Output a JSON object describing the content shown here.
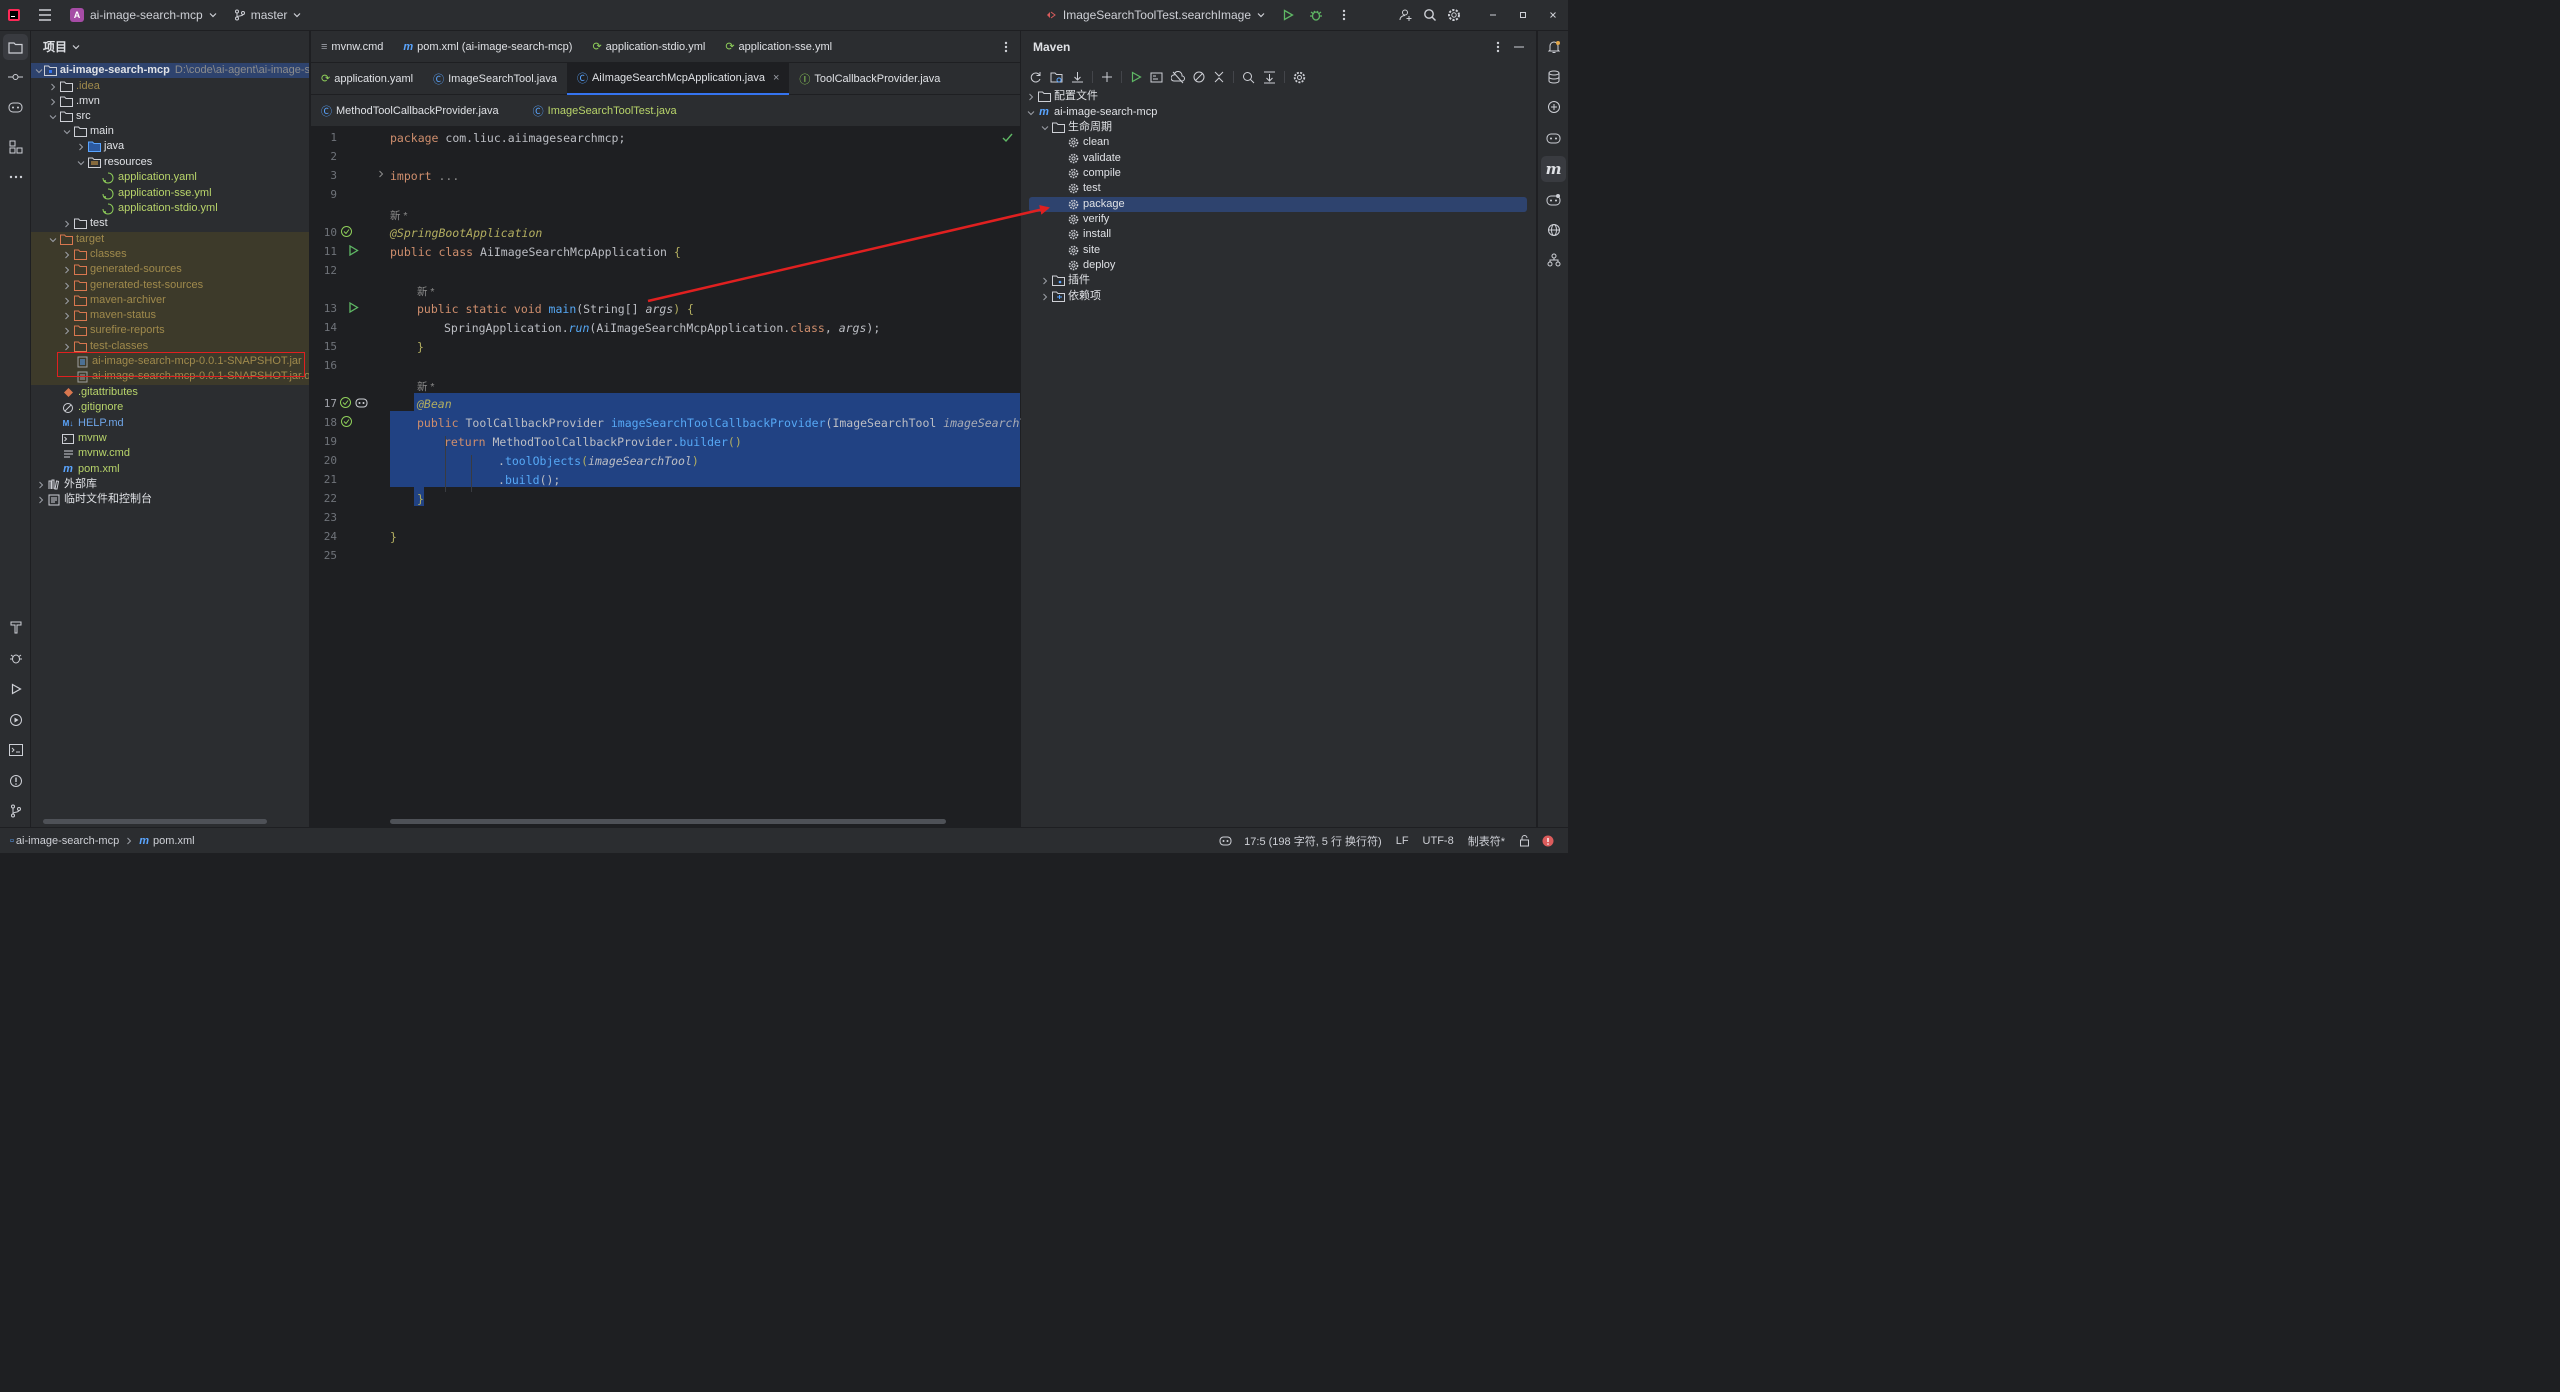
{
  "titlebar": {
    "project_badge": "A",
    "project_name": "ai-image-search-mcp",
    "branch": "master",
    "run_config": "ImageSearchToolTest.searchImage",
    "icons": [
      "app-logo-icon",
      "hamburger-menu-icon",
      "branch-icon",
      "run-icon",
      "debug-icon",
      "more-vert-icon",
      "add-user-icon",
      "search-icon",
      "settings-icon",
      "minimize-icon",
      "restore-icon",
      "close-icon"
    ]
  },
  "project_panel": {
    "title": "项目",
    "root_path": "D:\\code\\ai-agent\\ai-image-s",
    "items": [
      {
        "label": "ai-image-search-mcp",
        "type": "root"
      },
      {
        "label": ".idea",
        "type": "folder"
      },
      {
        "label": ".mvn",
        "type": "folder"
      },
      {
        "label": "src",
        "type": "folder"
      },
      {
        "label": "main",
        "type": "folder"
      },
      {
        "label": "java",
        "type": "folder"
      },
      {
        "label": "resources",
        "type": "folder"
      },
      {
        "label": "application.yaml",
        "type": "yml"
      },
      {
        "label": "application-sse.yml",
        "type": "yml"
      },
      {
        "label": "application-stdio.yml",
        "type": "yml"
      },
      {
        "label": "test",
        "type": "folder"
      },
      {
        "label": "target",
        "type": "folder"
      },
      {
        "label": "classes",
        "type": "folder"
      },
      {
        "label": "generated-sources",
        "type": "folder"
      },
      {
        "label": "generated-test-sources",
        "type": "folder"
      },
      {
        "label": "maven-archiver",
        "type": "folder"
      },
      {
        "label": "maven-status",
        "type": "folder"
      },
      {
        "label": "surefire-reports",
        "type": "folder"
      },
      {
        "label": "test-classes",
        "type": "folder"
      },
      {
        "label": "ai-image-search-mcp-0.0.1-SNAPSHOT.jar",
        "type": "jar"
      },
      {
        "label": "ai-image-search-mcp-0.0.1-SNAPSHOT.jar.orig",
        "type": "jar"
      },
      {
        "label": ".gitattributes",
        "type": "file"
      },
      {
        "label": ".gitignore",
        "type": "file"
      },
      {
        "label": "HELP.md",
        "type": "md"
      },
      {
        "label": "mvnw",
        "type": "file"
      },
      {
        "label": "mvnw.cmd",
        "type": "file"
      },
      {
        "label": "pom.xml",
        "type": "maven"
      },
      {
        "label": "外部库",
        "type": "lib"
      },
      {
        "label": "临时文件和控制台",
        "type": "scratch"
      }
    ]
  },
  "editor": {
    "tabs_row1": [
      "mvnw.cmd",
      "pom.xml (ai-image-search-mcp)",
      "application-stdio.yml",
      "application-sse.yml"
    ],
    "tabs_row2": [
      "application.yaml",
      "ImageSearchTool.java",
      "AiImageSearchMcpApplication.java",
      "ToolCallbackProvider.java"
    ],
    "tabs_row3": [
      "MethodToolCallbackProvider.java",
      "ImageSearchToolTest.java"
    ],
    "active_tab": "AiImageSearchMcpApplication.java",
    "line_numbers": [
      "1",
      "2",
      "3",
      "9",
      "",
      "10",
      "11",
      "12",
      "",
      "13",
      "14",
      "15",
      "16",
      "",
      "17",
      "18",
      "19",
      "20",
      "21",
      "22",
      "23",
      "24",
      "25"
    ],
    "hint_new": "新 *",
    "code": {
      "l1_kw": "package",
      "l1_rest": " com.liuc.aiimagesearchmcp;",
      "l3_kw": "import",
      "l3_rest": " ...",
      "l10": "@SpringBootApplication",
      "l11_kw": "public class",
      "l11_cls": " AiImageSearchMcpApplication",
      "l11_brace": " {",
      "l13_kw": "public static void",
      "l13_fn": " main",
      "l13_sig": "(String[] ",
      "l13_arg": "args",
      "l13_end": ") {",
      "l14_pre": "SpringApplication.",
      "l14_fn": "run",
      "l14_mid": "(AiImageSearchMcpApplication.",
      "l14_kw": "class",
      "l14_sep": ", ",
      "l14_arg": "args",
      "l14_end": ");",
      "l15": "}",
      "l17": "@Bean",
      "l18_kw": "public",
      "l18_type": " ToolCallbackProvider ",
      "l18_fn": "imageSearchToolCallbackProvider",
      "l18_sig": "(ImageSearchTool ",
      "l18_arg": "imageSearchToo",
      "l19_kw": "return",
      "l19_rest": " MethodToolCallbackProvider.",
      "l19_fn": "builder",
      "l19_end": "()",
      "l20_pre": ".",
      "l20_fn": "toolObjects",
      "l20_open": "(",
      "l20_arg": "imageSearchTool",
      "l20_close": ")",
      "l21_pre": ".",
      "l21_fn": "build",
      "l21_end": "();",
      "l22": "}",
      "l24": "}"
    }
  },
  "maven_panel": {
    "title": "Maven",
    "items": [
      {
        "label": "配置文件",
        "type": "folder"
      },
      {
        "label": "ai-image-search-mcp",
        "type": "maven"
      },
      {
        "label": "生命周期",
        "type": "folder"
      },
      {
        "label": "clean",
        "type": "goal"
      },
      {
        "label": "validate",
        "type": "goal"
      },
      {
        "label": "compile",
        "type": "goal"
      },
      {
        "label": "test",
        "type": "goal"
      },
      {
        "label": "package",
        "type": "goal"
      },
      {
        "label": "verify",
        "type": "goal"
      },
      {
        "label": "install",
        "type": "goal"
      },
      {
        "label": "site",
        "type": "goal"
      },
      {
        "label": "deploy",
        "type": "goal"
      },
      {
        "label": "插件",
        "type": "folder"
      },
      {
        "label": "依赖项",
        "type": "folder"
      }
    ],
    "selected": "package"
  },
  "statusbar": {
    "breadcrumb_project": "ai-image-search-mcp",
    "breadcrumb_file": "pom.xml",
    "position": "17:5 (198 字符, 5 行 换行符)",
    "line_sep": "LF",
    "encoding": "UTF-8",
    "indent": "制表符*"
  },
  "colors": {
    "accent": "#3574f0",
    "annotation_red": "#e02020",
    "selection": "#214283"
  }
}
